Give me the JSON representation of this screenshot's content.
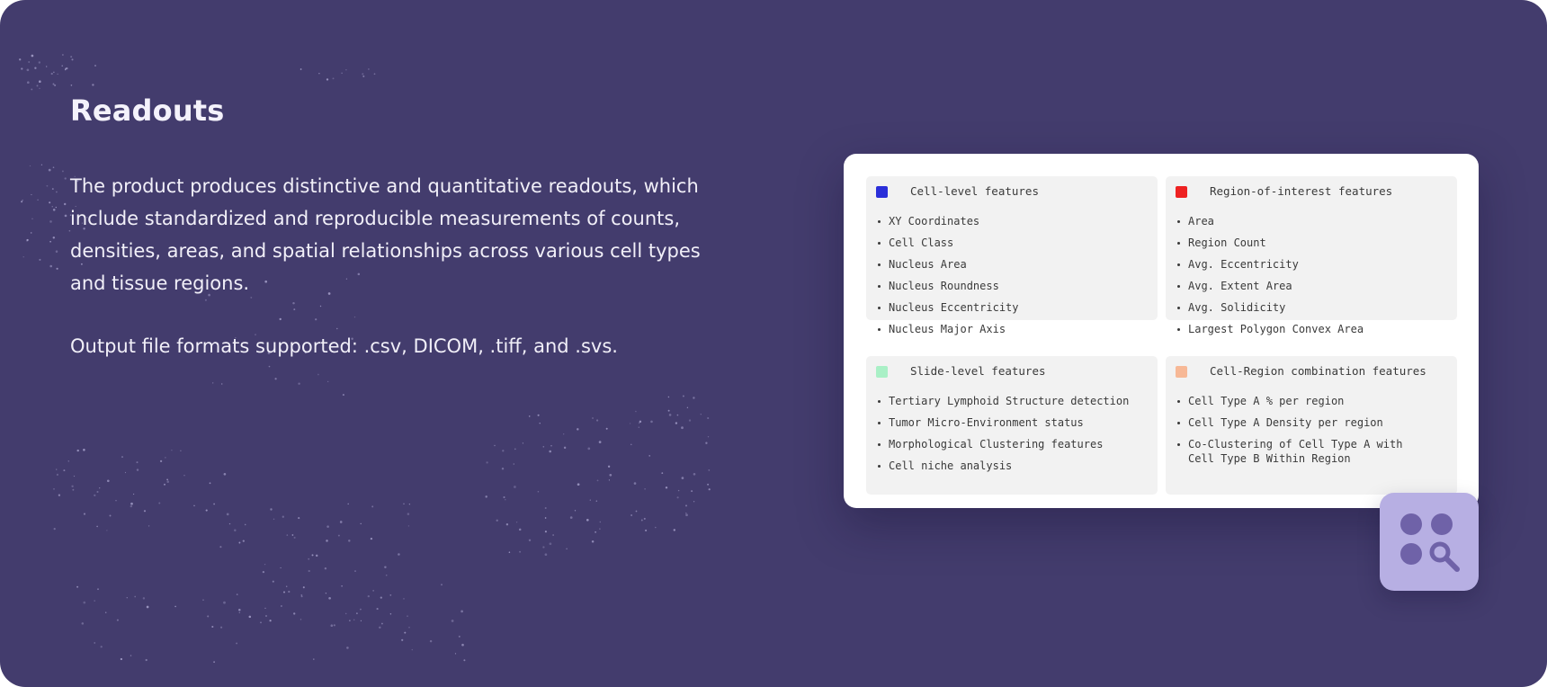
{
  "section": {
    "title": "Readouts",
    "description": "The product produces distinctive and quantitative readouts, which include standardized and reproducible measurements of counts, densities, areas, and spatial relationships across various cell types and tissue regions.",
    "formats": "Output file formats supported: .csv, DICOM, .tiff, and .svs."
  },
  "colors": {
    "background": "#433c6d",
    "cell_level": "#2b2fd9",
    "region_of_interest": "#ee2222",
    "slide_level": "#a9f0c6",
    "cell_region": "#f7b896",
    "badge": "#b7afe3",
    "badge_icon": "#6f62a8"
  },
  "features": {
    "cell_level": {
      "title": "Cell-level features",
      "items": [
        "XY Coordinates",
        "Cell Class",
        "Nucleus Area",
        "Nucleus Roundness",
        "Nucleus Eccentricity",
        "Nucleus Major Axis"
      ]
    },
    "region_of_interest": {
      "title": "Region-of-interest features",
      "items": [
        "Area",
        "Region Count",
        "Avg. Eccentricity",
        "Avg. Extent Area",
        "Avg. Solidicity",
        "Largest Polygon Convex Area"
      ]
    },
    "slide_level": {
      "title": "Slide-level features",
      "items": [
        "Tertiary Lymphoid Structure detection",
        "Tumor Micro-Environment status",
        "Morphological Clustering features",
        "Cell niche analysis"
      ]
    },
    "cell_region": {
      "title": "Cell-Region combination features",
      "items": [
        "Cell Type A % per region",
        "Cell Type A Density per region",
        "Co-Clustering of Cell Type A with\nCell Type B Within Region"
      ]
    }
  },
  "badge": {
    "icon": "cells-search-icon"
  }
}
